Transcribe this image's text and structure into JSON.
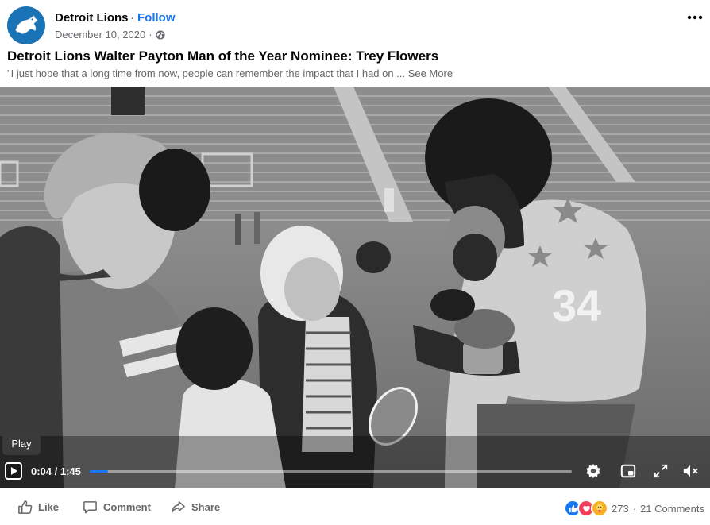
{
  "header": {
    "page_name": "Detroit Lions",
    "separator": "·",
    "follow_label": "Follow",
    "date": "December 10, 2020",
    "date_separator": "·",
    "privacy_icon": "globe-icon",
    "more_icon": "more-horizontal-icon"
  },
  "post": {
    "title": "Detroit Lions Walter Payton Man of the Year Nominee: Trey Flowers",
    "text": "\"I just hope that a long time from now, people can remember the impact that I had on ...",
    "see_more": "See More"
  },
  "video": {
    "tooltip": "Play",
    "time": "0:04 / 1:45",
    "progress": 0.038,
    "icons": [
      "play-icon",
      "settings-icon",
      "picture-in-picture-icon",
      "fullscreen-icon",
      "mute-icon"
    ],
    "jersey_number": "34"
  },
  "actions": {
    "like_label": "Like",
    "comment_label": "Comment",
    "share_label": "Share",
    "reaction_count": "273",
    "comments_count": "21 Comments",
    "reaction_icons": [
      "like-reaction-icon",
      "love-reaction-icon",
      "care-reaction-icon"
    ]
  },
  "colors": {
    "accent": "#1877f2",
    "text_secondary": "#65676b",
    "avatar_bg": "#1a73b6"
  }
}
